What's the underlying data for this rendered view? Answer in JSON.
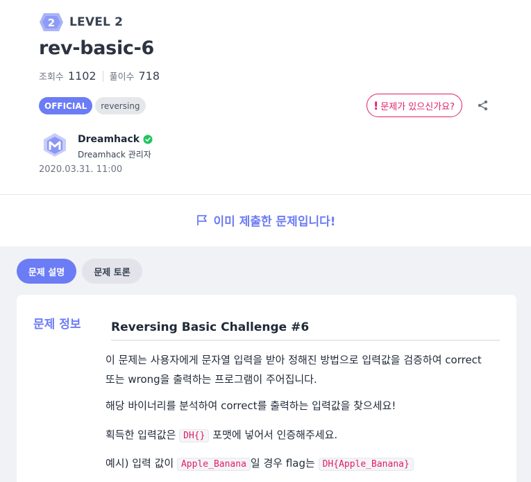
{
  "level": {
    "badge_number": "2",
    "label": "LEVEL 2"
  },
  "problem": {
    "title": "rev-basic-6"
  },
  "stats": {
    "views_label": "조회수",
    "views_value": "1102",
    "solves_label": "풀이수",
    "solves_value": "718"
  },
  "tags": [
    "OFFICIAL",
    "reversing"
  ],
  "report_button": {
    "icon_text": "!",
    "label": "문제가 있으신가요?"
  },
  "author": {
    "name": "Dreamhack",
    "role": "Dreamhack 관리자",
    "date": "2020.03.31. 11:00"
  },
  "submitted_notice": "이미 제출한 문제입니다!",
  "tabs": {
    "description": "문제 설명",
    "discussion": "문제 토론"
  },
  "info": {
    "section_label": "문제 정보",
    "heading": "Reversing Basic Challenge #6",
    "p1_line1": "이 문제는 사용자에게 문자열 입력을 받아 정해진 방법으로 입력값을 검증하여 correct",
    "p1_line2": "또는 wrong을 출력하는 프로그램이 주어집니다.",
    "p2": "해당 바이너리를 분석하여 correct를 출력하는 입력값을 찾으세요!",
    "p3_before": "획득한 입력값은",
    "p3_code": "DH{}",
    "p3_after": "포맷에 넣어서 인증해주세요.",
    "p4_a": "예시) 입력 값이",
    "p4_code1": "Apple_Banana",
    "p4_b": "일 경우 flag는",
    "p4_code2": "DH{Apple_Banana}"
  },
  "colors": {
    "accent": "#6b7cf5",
    "danger": "#e11d68",
    "verified": "#22c55e"
  }
}
